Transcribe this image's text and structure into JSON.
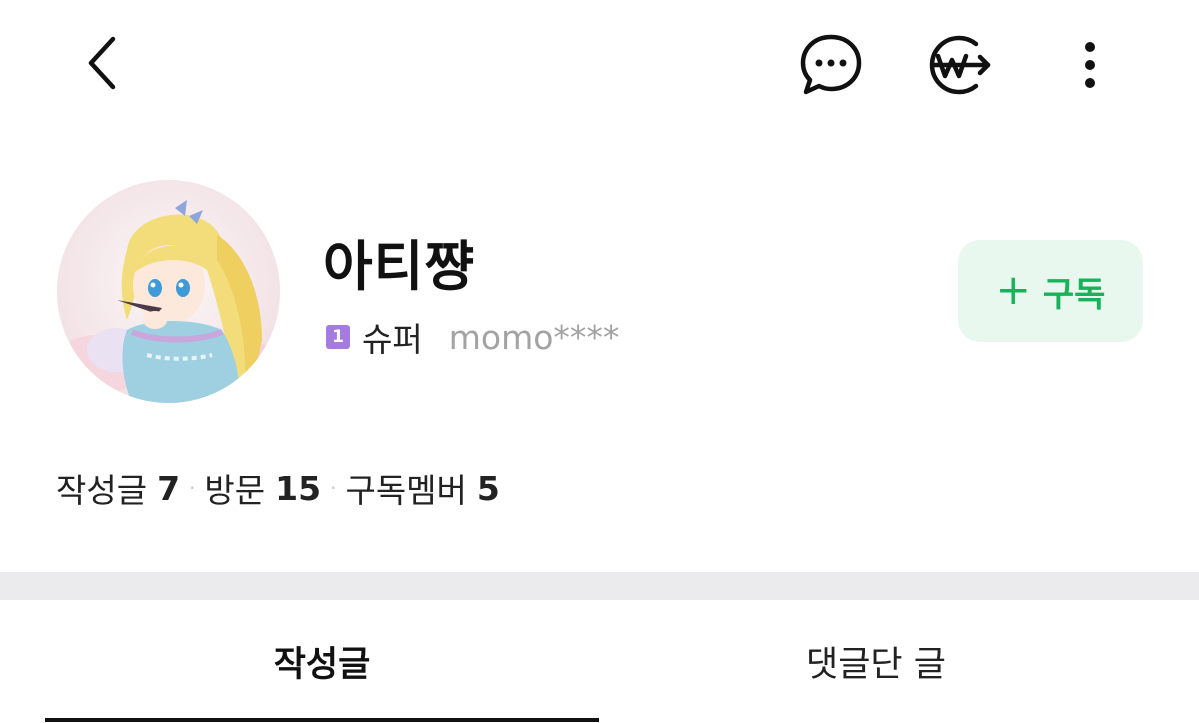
{
  "header": {
    "back_icon": "chevron-left-icon",
    "chat_icon": "chat-bubble-icon",
    "pay_icon": "w-pay-icon",
    "more_icon": "more-vertical-icon"
  },
  "profile": {
    "nickname": "아티쨩",
    "grade_number": "1",
    "grade_label": "슈퍼",
    "user_id": "momo****",
    "subscribe_plus": "+",
    "subscribe_label": "구독",
    "colors": {
      "accent_green": "#18b25a",
      "subscribe_bg": "#e8f8ef",
      "grade_purple": "#a67be0"
    }
  },
  "stats": {
    "posts_label": "작성글",
    "posts_count": "7",
    "visits_label": "방문",
    "visits_count": "15",
    "members_label": "구독멤버",
    "members_count": "5",
    "separator": "·"
  },
  "tabs": {
    "posts": "작성글",
    "commented": "댓글단 글"
  }
}
